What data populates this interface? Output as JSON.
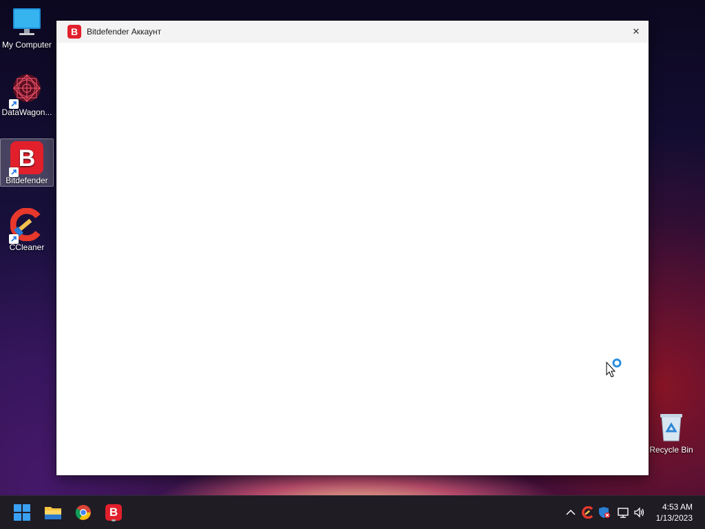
{
  "desktop": {
    "icons": [
      {
        "label": "My Computer",
        "icon": "monitor-icon"
      },
      {
        "label": "DataWagon...",
        "icon": "datawagon-icon"
      },
      {
        "label": "Bitdefender",
        "icon": "bitdefender-icon"
      },
      {
        "label": "CCleaner",
        "icon": "ccleaner-icon"
      },
      {
        "label": "Recycle Bin",
        "icon": "recycle-bin-icon"
      }
    ]
  },
  "window": {
    "title": "Bitdefender Аккаунт",
    "logo_letter": "B",
    "close_glyph": "✕",
    "accent": "#e2202c"
  },
  "taskbar": {
    "apps": [
      {
        "name": "start",
        "icon": "windows-start-icon"
      },
      {
        "name": "file-explorer",
        "icon": "folder-icon"
      },
      {
        "name": "chrome",
        "icon": "chrome-icon"
      },
      {
        "name": "bitdefender",
        "icon": "bitdefender-icon",
        "letter": "B"
      }
    ],
    "tray": [
      "chevron-up-icon",
      "ccleaner-tray-icon",
      "security-tray-icon",
      "network-icon",
      "volume-icon"
    ],
    "time": "4:53 AM",
    "date": "1/13/2023"
  }
}
